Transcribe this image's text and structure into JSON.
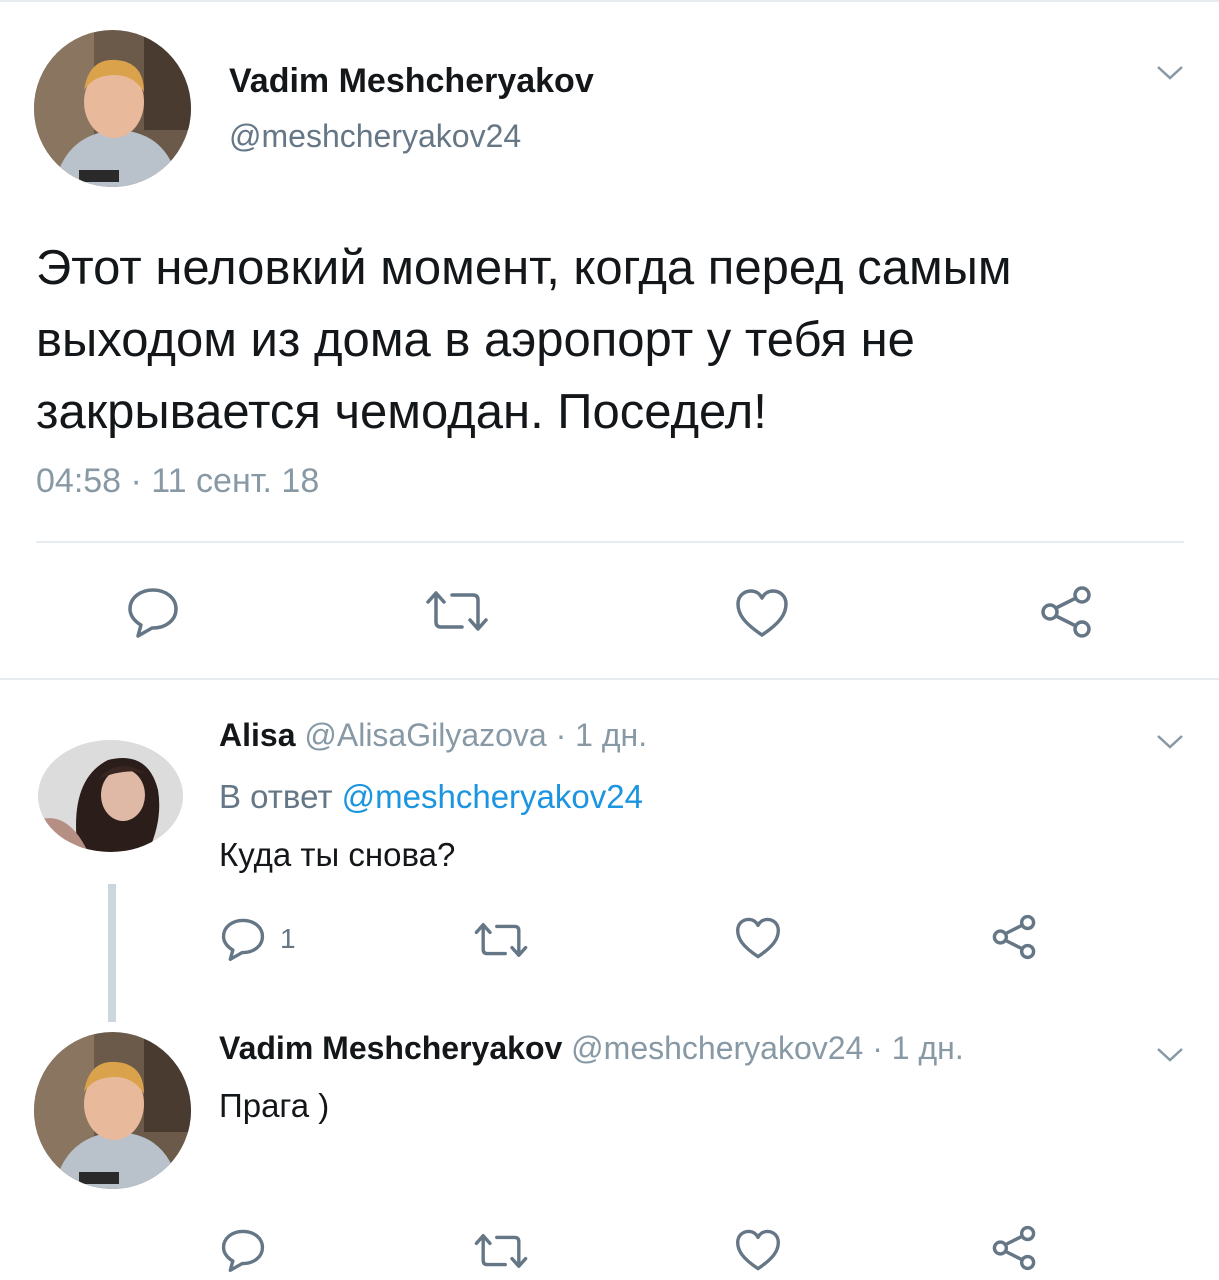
{
  "main_tweet": {
    "author_name": "Vadim Meshcheryakov",
    "author_handle": "@meshcheryakov24",
    "text": "Этот неловкий момент, когда перед самым выходом из дома в аэропорт у тебя не закрывается чемодан. Поседел!",
    "timestamp": "04:58 · 11 сент. 18",
    "actions": [
      "reply-icon",
      "retweet-icon",
      "like-icon",
      "share-icon"
    ]
  },
  "replies": [
    {
      "author_name": "Alisa",
      "meta": "@AlisaGilyazova · 1 дн.",
      "reply_to_label": "В ответ",
      "reply_to_handle": "@meshcheryakov24",
      "text": "Куда ты снова?",
      "reply_count": "1"
    },
    {
      "author_name": "Vadim Meshcheryakov",
      "meta": "@meshcheryakov24 · 1 дн.",
      "text": "Прага )"
    }
  ],
  "colors": {
    "text": "#14171a",
    "secondary": "#657786",
    "light": "#8899a6",
    "link": "#1b95e0",
    "icon": "#657786",
    "divider": "#e6ecf0"
  }
}
